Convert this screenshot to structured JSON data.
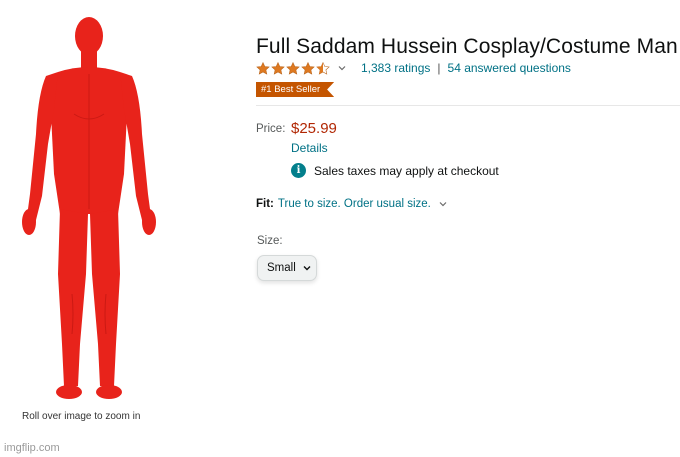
{
  "image_panel": {
    "zoom_hint": "Roll over image to zoom in",
    "watermark": "imgflip.com",
    "suit_color": "#e8231b"
  },
  "product": {
    "title": "Full Saddam Hussein Cosplay/Costume Man",
    "rating": {
      "stars": 4.5,
      "star_color": "#de7921",
      "count_text": "1,383 ratings",
      "separator": "|",
      "questions_text": "54 answered questions"
    },
    "badge": {
      "text": "#1 Best Seller",
      "color": "#c45500"
    },
    "price": {
      "label": "Price:",
      "value": "$25.99",
      "details_link": "Details",
      "tax_note": "Sales taxes may apply at checkout",
      "info_icon": "info-icon"
    },
    "fit": {
      "label": "Fit:",
      "value": "True to size. Order usual size."
    },
    "size": {
      "label": "Size:",
      "selected": "Small"
    }
  },
  "colors": {
    "link": "#007185",
    "price": "#b12704",
    "info": "#037f8c"
  }
}
